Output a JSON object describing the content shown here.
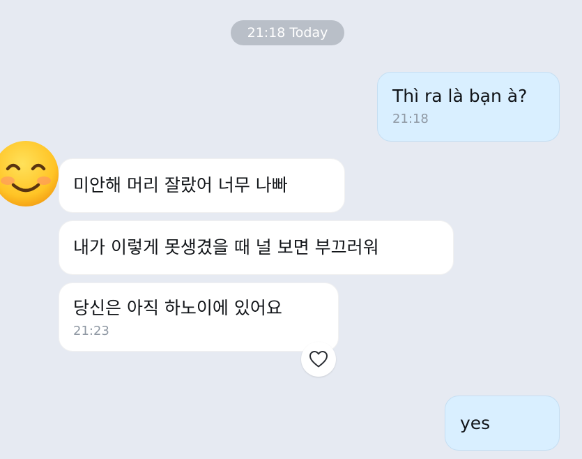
{
  "date_separator": "21:18 Today",
  "messages": [
    {
      "direction": "out",
      "text": "Thì ra là bạn à?",
      "time": "21:18"
    },
    {
      "direction": "in",
      "text": "미안해 머리 잘랐어 너무 나빠"
    },
    {
      "direction": "in",
      "text": "내가 이렇게 못생겼을 때 널 보면 부끄러워"
    },
    {
      "direction": "in",
      "text": "당신은 아직 하노이에 있어요",
      "time": "21:23"
    },
    {
      "direction": "out",
      "text": "yes"
    }
  ],
  "avatar_icon": "smiling-face-emoji-icon",
  "reaction_icon": "heart-outline-icon",
  "colors": {
    "background": "#e6eaf2",
    "outgoing_bubble": "#d9efff",
    "incoming_bubble": "#ffffff",
    "timestamp": "#8f98a3",
    "date_pill": "#b9bfc8"
  }
}
